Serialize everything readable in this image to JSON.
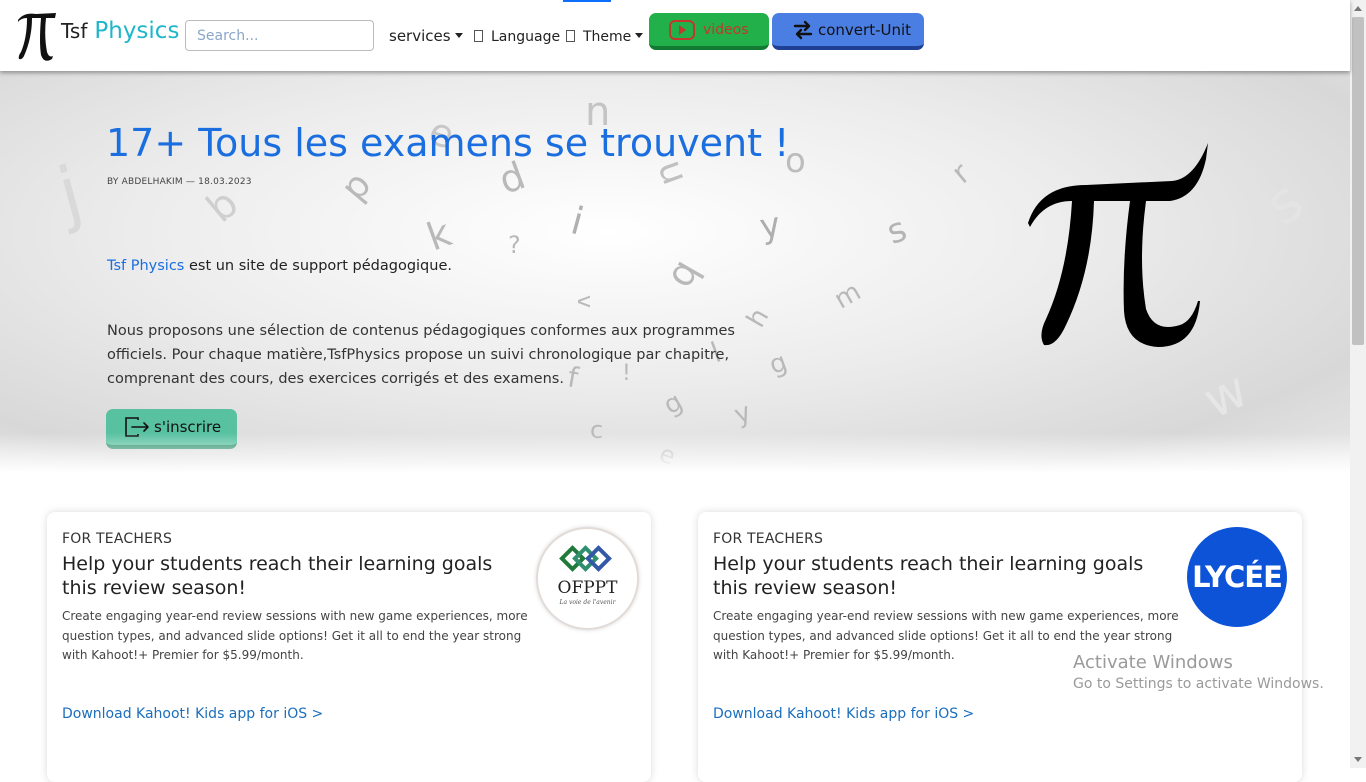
{
  "navbar": {
    "brand_part1": "Tsf",
    "brand_part2": "Physics",
    "search_placeholder": "Search...",
    "services_label": "services",
    "language_label": "Language",
    "theme_label": "Theme",
    "videos_label": "videos",
    "convert_label": "convert-Unit",
    "icons": [
      "pi-logo-icon",
      "caret-down-icon",
      "youtube-play-icon",
      "swap-arrows-icon"
    ]
  },
  "hero": {
    "title": "17+ Tous les examens se trouvent !",
    "byline": "BY ABDELHAKIM — 18.03.2023",
    "intro_brand": "Tsf Physics",
    "intro_rest": " est un site de support pédagogique.",
    "description": "Nous proposons une sélection de contenus pédagogiques conformes aux programmes officiels. Pour chaque matière,TsfPhysics propose un suivi chronologique par chapitre, comprenant des cours, des exercices corrigés et des examens.",
    "signup_label": "s'inscrire",
    "background_letters": [
      "j",
      "b",
      "p",
      "e",
      "d",
      "u",
      "k",
      "?",
      "i",
      "n",
      "o",
      "q",
      "v",
      "h",
      "l",
      "f",
      "!",
      "y",
      "g",
      "m",
      "s",
      "r",
      "c",
      "w"
    ]
  },
  "cards": [
    {
      "kicker": "FOR TEACHERS",
      "title": "Help your students reach their learning goals this review season!",
      "text": "Create engaging year-end review sessions with new game experiences, more question types, and advanced slide options! Get it all to end the year strong with Kahoot!+ Premier for $5.99/month.",
      "link": "Download Kahoot! Kids app for iOS >",
      "logo_text": "OFPPT",
      "logo_tagline": "La voie de l'avenir"
    },
    {
      "kicker": "FOR TEACHERS",
      "title": "Help your students reach their learning goals this review season!",
      "text": "Create engaging year-end review sessions with new game experiences, more question types, and advanced slide options! Get it all to end the year strong with Kahoot!+ Premier for $5.99/month.",
      "link": "Download Kahoot! Kids app for iOS >",
      "logo_text": "LYCÉE"
    }
  ],
  "overlay": {
    "line1": "Activate Windows",
    "line2": "Go to Settings to activate Windows."
  },
  "colors": {
    "brand_blue": "#1a6ee0",
    "brand_teal": "#1fb6c9",
    "videos_green": "#22b04b",
    "convert_blue": "#4a7ee3",
    "signup_green": "#58c1a0",
    "lycee_blue": "#0d53d8"
  }
}
